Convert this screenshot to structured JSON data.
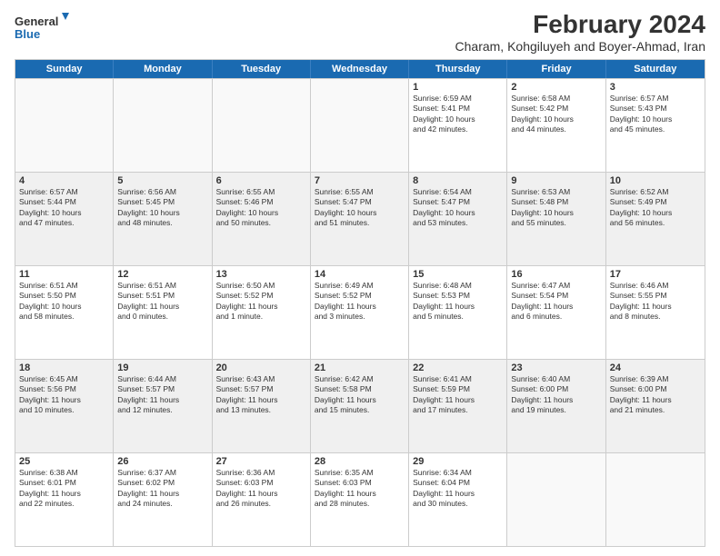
{
  "logo": {
    "line1": "General",
    "line2": "Blue"
  },
  "title": "February 2024",
  "subtitle": "Charam, Kohgiluyeh and Boyer-Ahmad, Iran",
  "weekdays": [
    "Sunday",
    "Monday",
    "Tuesday",
    "Wednesday",
    "Thursday",
    "Friday",
    "Saturday"
  ],
  "rows": [
    [
      {
        "day": "",
        "info": ""
      },
      {
        "day": "",
        "info": ""
      },
      {
        "day": "",
        "info": ""
      },
      {
        "day": "",
        "info": ""
      },
      {
        "day": "1",
        "info": "Sunrise: 6:59 AM\nSunset: 5:41 PM\nDaylight: 10 hours\nand 42 minutes."
      },
      {
        "day": "2",
        "info": "Sunrise: 6:58 AM\nSunset: 5:42 PM\nDaylight: 10 hours\nand 44 minutes."
      },
      {
        "day": "3",
        "info": "Sunrise: 6:57 AM\nSunset: 5:43 PM\nDaylight: 10 hours\nand 45 minutes."
      }
    ],
    [
      {
        "day": "4",
        "info": "Sunrise: 6:57 AM\nSunset: 5:44 PM\nDaylight: 10 hours\nand 47 minutes."
      },
      {
        "day": "5",
        "info": "Sunrise: 6:56 AM\nSunset: 5:45 PM\nDaylight: 10 hours\nand 48 minutes."
      },
      {
        "day": "6",
        "info": "Sunrise: 6:55 AM\nSunset: 5:46 PM\nDaylight: 10 hours\nand 50 minutes."
      },
      {
        "day": "7",
        "info": "Sunrise: 6:55 AM\nSunset: 5:47 PM\nDaylight: 10 hours\nand 51 minutes."
      },
      {
        "day": "8",
        "info": "Sunrise: 6:54 AM\nSunset: 5:47 PM\nDaylight: 10 hours\nand 53 minutes."
      },
      {
        "day": "9",
        "info": "Sunrise: 6:53 AM\nSunset: 5:48 PM\nDaylight: 10 hours\nand 55 minutes."
      },
      {
        "day": "10",
        "info": "Sunrise: 6:52 AM\nSunset: 5:49 PM\nDaylight: 10 hours\nand 56 minutes."
      }
    ],
    [
      {
        "day": "11",
        "info": "Sunrise: 6:51 AM\nSunset: 5:50 PM\nDaylight: 10 hours\nand 58 minutes."
      },
      {
        "day": "12",
        "info": "Sunrise: 6:51 AM\nSunset: 5:51 PM\nDaylight: 11 hours\nand 0 minutes."
      },
      {
        "day": "13",
        "info": "Sunrise: 6:50 AM\nSunset: 5:52 PM\nDaylight: 11 hours\nand 1 minute."
      },
      {
        "day": "14",
        "info": "Sunrise: 6:49 AM\nSunset: 5:52 PM\nDaylight: 11 hours\nand 3 minutes."
      },
      {
        "day": "15",
        "info": "Sunrise: 6:48 AM\nSunset: 5:53 PM\nDaylight: 11 hours\nand 5 minutes."
      },
      {
        "day": "16",
        "info": "Sunrise: 6:47 AM\nSunset: 5:54 PM\nDaylight: 11 hours\nand 6 minutes."
      },
      {
        "day": "17",
        "info": "Sunrise: 6:46 AM\nSunset: 5:55 PM\nDaylight: 11 hours\nand 8 minutes."
      }
    ],
    [
      {
        "day": "18",
        "info": "Sunrise: 6:45 AM\nSunset: 5:56 PM\nDaylight: 11 hours\nand 10 minutes."
      },
      {
        "day": "19",
        "info": "Sunrise: 6:44 AM\nSunset: 5:57 PM\nDaylight: 11 hours\nand 12 minutes."
      },
      {
        "day": "20",
        "info": "Sunrise: 6:43 AM\nSunset: 5:57 PM\nDaylight: 11 hours\nand 13 minutes."
      },
      {
        "day": "21",
        "info": "Sunrise: 6:42 AM\nSunset: 5:58 PM\nDaylight: 11 hours\nand 15 minutes."
      },
      {
        "day": "22",
        "info": "Sunrise: 6:41 AM\nSunset: 5:59 PM\nDaylight: 11 hours\nand 17 minutes."
      },
      {
        "day": "23",
        "info": "Sunrise: 6:40 AM\nSunset: 6:00 PM\nDaylight: 11 hours\nand 19 minutes."
      },
      {
        "day": "24",
        "info": "Sunrise: 6:39 AM\nSunset: 6:00 PM\nDaylight: 11 hours\nand 21 minutes."
      }
    ],
    [
      {
        "day": "25",
        "info": "Sunrise: 6:38 AM\nSunset: 6:01 PM\nDaylight: 11 hours\nand 22 minutes."
      },
      {
        "day": "26",
        "info": "Sunrise: 6:37 AM\nSunset: 6:02 PM\nDaylight: 11 hours\nand 24 minutes."
      },
      {
        "day": "27",
        "info": "Sunrise: 6:36 AM\nSunset: 6:03 PM\nDaylight: 11 hours\nand 26 minutes."
      },
      {
        "day": "28",
        "info": "Sunrise: 6:35 AM\nSunset: 6:03 PM\nDaylight: 11 hours\nand 28 minutes."
      },
      {
        "day": "29",
        "info": "Sunrise: 6:34 AM\nSunset: 6:04 PM\nDaylight: 11 hours\nand 30 minutes."
      },
      {
        "day": "",
        "info": ""
      },
      {
        "day": "",
        "info": ""
      }
    ]
  ]
}
